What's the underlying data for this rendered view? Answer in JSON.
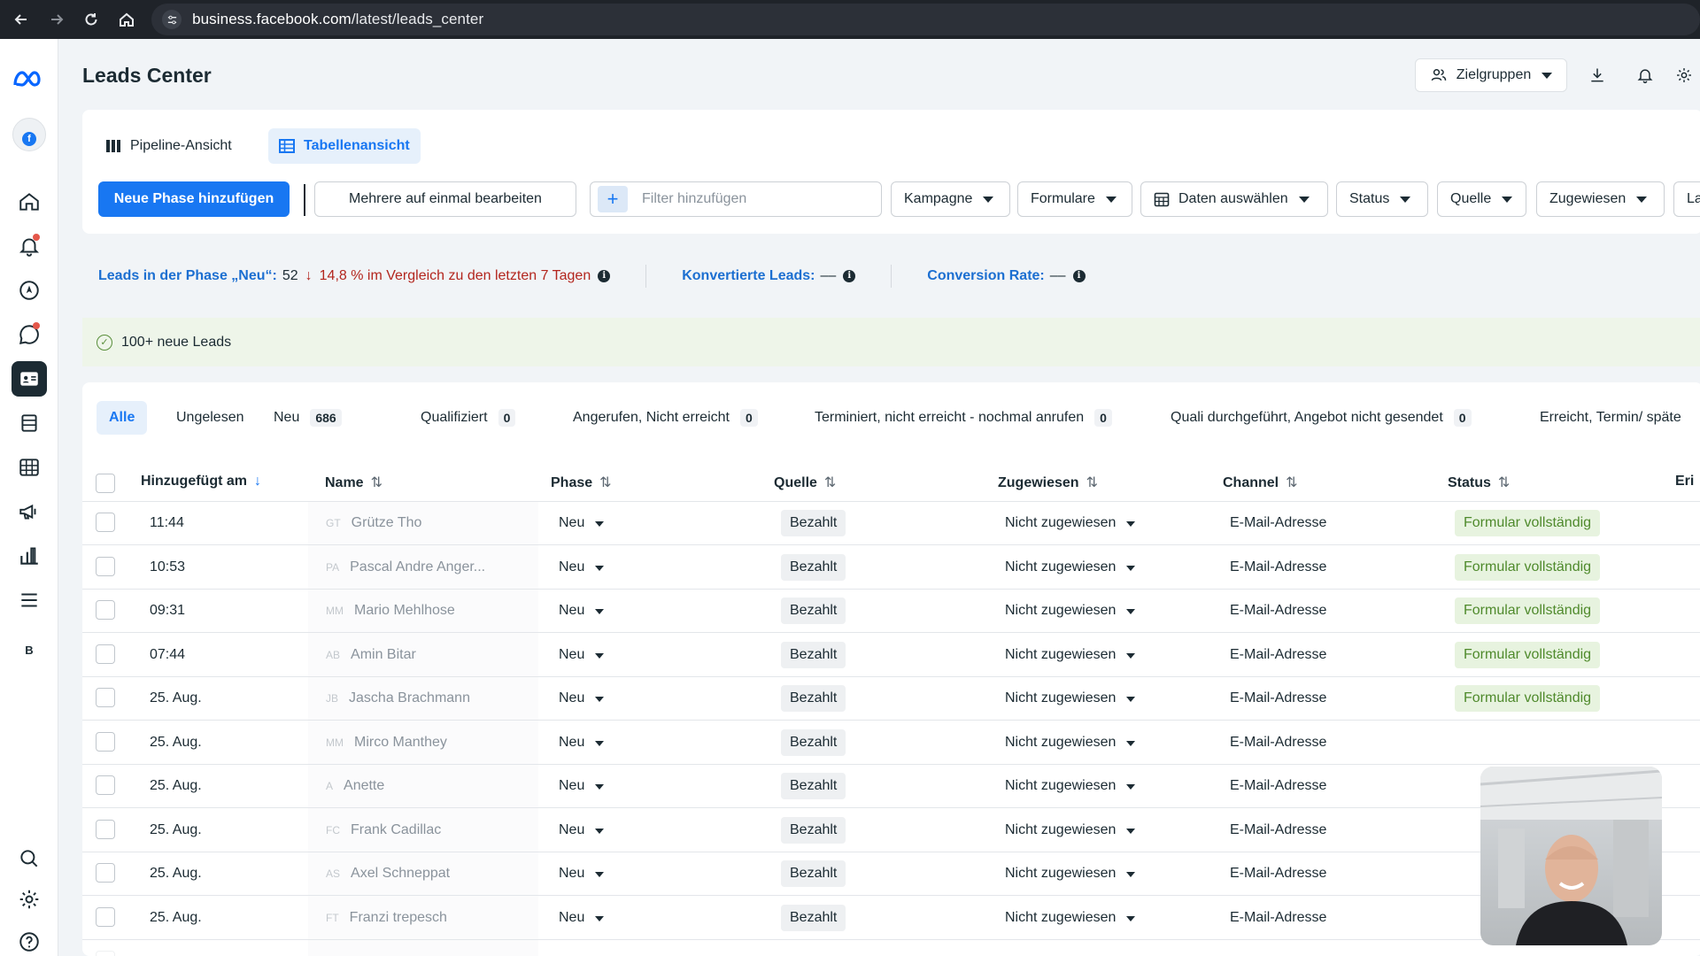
{
  "browser": {
    "url_domain": "business.facebook.com",
    "url_path": "/latest/leads_center"
  },
  "header": {
    "title": "Leads Center",
    "audience_button": "Zielgruppen"
  },
  "views": {
    "pipeline": "Pipeline-Ansicht",
    "table": "Tabellenansicht"
  },
  "toolbar": {
    "add_phase": "Neue Phase hinzufügen",
    "bulk_edit": "Mehrere auf einmal bearbeiten",
    "filter_placeholder": "Filter hinzufügen",
    "campaign": "Kampagne",
    "forms": "Formulare",
    "select_data": "Daten auswählen",
    "status": "Status",
    "source": "Quelle",
    "assigned": "Zugewiesen",
    "label": "Label"
  },
  "stats": {
    "new_phase_label": "Leads in der Phase „Neu“:",
    "new_phase_value": "52",
    "new_phase_change": "14,8 % im Vergleich zu den letzten 7 Tagen",
    "converted_label": "Konvertierte Leads:",
    "converted_value": "––",
    "conversion_label": "Conversion Rate:",
    "conversion_value": "––"
  },
  "banner": {
    "text": "100+ neue Leads"
  },
  "phase_tabs": [
    {
      "label": "Alle",
      "count": ""
    },
    {
      "label": "Ungelesen",
      "count": ""
    },
    {
      "label": "Neu",
      "count": "686"
    },
    {
      "label": "Qualifiziert",
      "count": "0"
    },
    {
      "label": "Angerufen, Nicht erreicht",
      "count": "0"
    },
    {
      "label": "Terminiert, nicht erreicht - nochmal anrufen",
      "count": "0"
    },
    {
      "label": "Quali durchgeführt, Angebot nicht gesendet",
      "count": "0"
    },
    {
      "label": "Erreicht, Termin/ späte",
      "count": ""
    }
  ],
  "columns": {
    "added": "Hinzugefügt am",
    "name": "Name",
    "phase": "Phase",
    "source": "Quelle",
    "assigned": "Zugewiesen",
    "channel": "Channel",
    "status": "Status",
    "more": "Eri"
  },
  "rows": [
    {
      "date": "11:44",
      "initials": "GT",
      "name": "Grütze Tho",
      "phase": "Neu",
      "source": "Bezahlt",
      "assigned": "Nicht zugewiesen",
      "channel": "E-Mail-Adresse",
      "status": "Formular vollständig"
    },
    {
      "date": "10:53",
      "initials": "PA",
      "name": "Pascal Andre Anger...",
      "phase": "Neu",
      "source": "Bezahlt",
      "assigned": "Nicht zugewiesen",
      "channel": "E-Mail-Adresse",
      "status": "Formular vollständig"
    },
    {
      "date": "09:31",
      "initials": "MM",
      "name": "Mario Mehlhose",
      "phase": "Neu",
      "source": "Bezahlt",
      "assigned": "Nicht zugewiesen",
      "channel": "E-Mail-Adresse",
      "status": "Formular vollständig"
    },
    {
      "date": "07:44",
      "initials": "AB",
      "name": "Amin Bitar",
      "phase": "Neu",
      "source": "Bezahlt",
      "assigned": "Nicht zugewiesen",
      "channel": "E-Mail-Adresse",
      "status": "Formular vollständig"
    },
    {
      "date": "25. Aug.",
      "initials": "JB",
      "name": "Jascha Brachmann",
      "phase": "Neu",
      "source": "Bezahlt",
      "assigned": "Nicht zugewiesen",
      "channel": "E-Mail-Adresse",
      "status": "Formular vollständig"
    },
    {
      "date": "25. Aug.",
      "initials": "MM",
      "name": "Mirco Manthey",
      "phase": "Neu",
      "source": "Bezahlt",
      "assigned": "Nicht zugewiesen",
      "channel": "E-Mail-Adresse",
      "status": ""
    },
    {
      "date": "25. Aug.",
      "initials": "A",
      "name": "Anette",
      "phase": "Neu",
      "source": "Bezahlt",
      "assigned": "Nicht zugewiesen",
      "channel": "E-Mail-Adresse",
      "status": ""
    },
    {
      "date": "25. Aug.",
      "initials": "FC",
      "name": "Frank Cadillac",
      "phase": "Neu",
      "source": "Bezahlt",
      "assigned": "Nicht zugewiesen",
      "channel": "E-Mail-Adresse",
      "status": ""
    },
    {
      "date": "25. Aug.",
      "initials": "AS",
      "name": "Axel Schneppat",
      "phase": "Neu",
      "source": "Bezahlt",
      "assigned": "Nicht zugewiesen",
      "channel": "E-Mail-Adresse",
      "status": ""
    },
    {
      "date": "25. Aug.",
      "initials": "FT",
      "name": "Franzi trepesch",
      "phase": "Neu",
      "source": "Bezahlt",
      "assigned": "Nicht zugewiesen",
      "channel": "E-Mail-Adresse",
      "status": ""
    }
  ],
  "icons": {
    "back": "arrow-left-icon",
    "forward": "arrow-right-icon",
    "reload": "reload-icon",
    "home": "home-icon",
    "meta_logo": "meta-logo-icon",
    "download": "download-icon",
    "bell": "bell-icon",
    "gear": "gear-icon"
  },
  "colors": {
    "accent": "#1877f2",
    "status_green": "#4f8a2c",
    "down_red": "#b3261e"
  }
}
